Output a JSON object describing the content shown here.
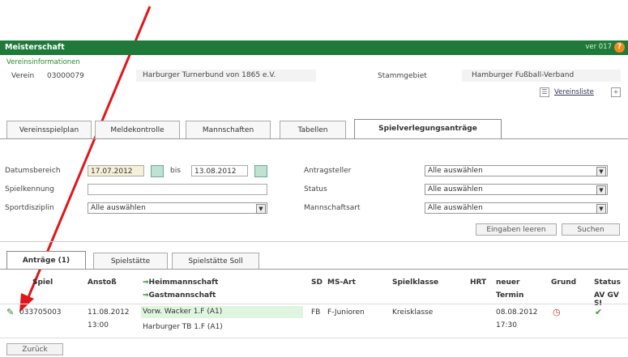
{
  "window": {
    "title": "Meisterschaft",
    "version": "ver 017",
    "help_icon": "help-icon"
  },
  "verein_info": {
    "section_label": "Vereinsinformationen",
    "verein_label": "Verein",
    "verein_number": "03000079",
    "verein_name": "Harburger Turnerbund von 1865 e.V.",
    "stammgebiet_label": "Stammgebiet",
    "stammgebiet_value": "Hamburger Fußball-Verband",
    "vereinsliste_link": "Vereinsliste"
  },
  "main_tabs": [
    {
      "label": "Vereinsspielplan"
    },
    {
      "label": "Meldekontrolle"
    },
    {
      "label": "Mannschaften"
    },
    {
      "label": "Tabellen"
    },
    {
      "label": "Spielverlegungsanträge"
    }
  ],
  "filters": {
    "datumsbereich_label": "Datumsbereich",
    "date_from": "17.07.2012",
    "bis_label": "bis",
    "date_to": "13.08.2012",
    "spielkennung_label": "Spielkennung",
    "spielkennung_value": "",
    "sportdisziplin_label": "Sportdisziplin",
    "sportdisziplin_value": "Alle auswählen",
    "antragsteller_label": "Antragsteller",
    "antragsteller_value": "Alle auswählen",
    "status_label": "Status",
    "status_value": "Alle auswählen",
    "mannschaftsart_label": "Mannschaftsart",
    "mannschaftsart_value": "Alle auswählen",
    "clear_button": "Eingaben leeren",
    "search_button": "Suchen"
  },
  "sub_tabs": [
    {
      "label": "Anträge (1)"
    },
    {
      "label": "Spielstätte"
    },
    {
      "label": "Spielstätte Soll"
    }
  ],
  "table": {
    "headers": {
      "spiel": "Spiel",
      "anstoss": "Anstoß",
      "heim": "Heimmannschaft",
      "gast": "Gastmannschaft",
      "sd": "SD",
      "ms_art": "MS-Art",
      "spielklasse": "Spielklasse",
      "hrt": "HRT",
      "neuer": "neuer",
      "termin": "Termin",
      "grund": "Grund",
      "status": "Status",
      "status_sub": "AV GV SI"
    },
    "rows": [
      {
        "spiel": "033705003",
        "anstoss_date": "11.08.2012",
        "anstoss_time": "13:00",
        "heim": "Vorw. Wacker 1.F (A1)",
        "gast": "Harburger TB 1.F (A1)",
        "sd": "FB",
        "ms_art": "F-Junioren",
        "spielklasse": "Kreisklasse",
        "hrt": "",
        "neuer_date": "08.08.2012",
        "neuer_time": "17:30"
      }
    ]
  },
  "footer": {
    "back_button": "Zurück"
  },
  "colors": {
    "titlebar": "#1f7a3a",
    "arrow": "#e0161b",
    "highlight": "#dff5df"
  }
}
